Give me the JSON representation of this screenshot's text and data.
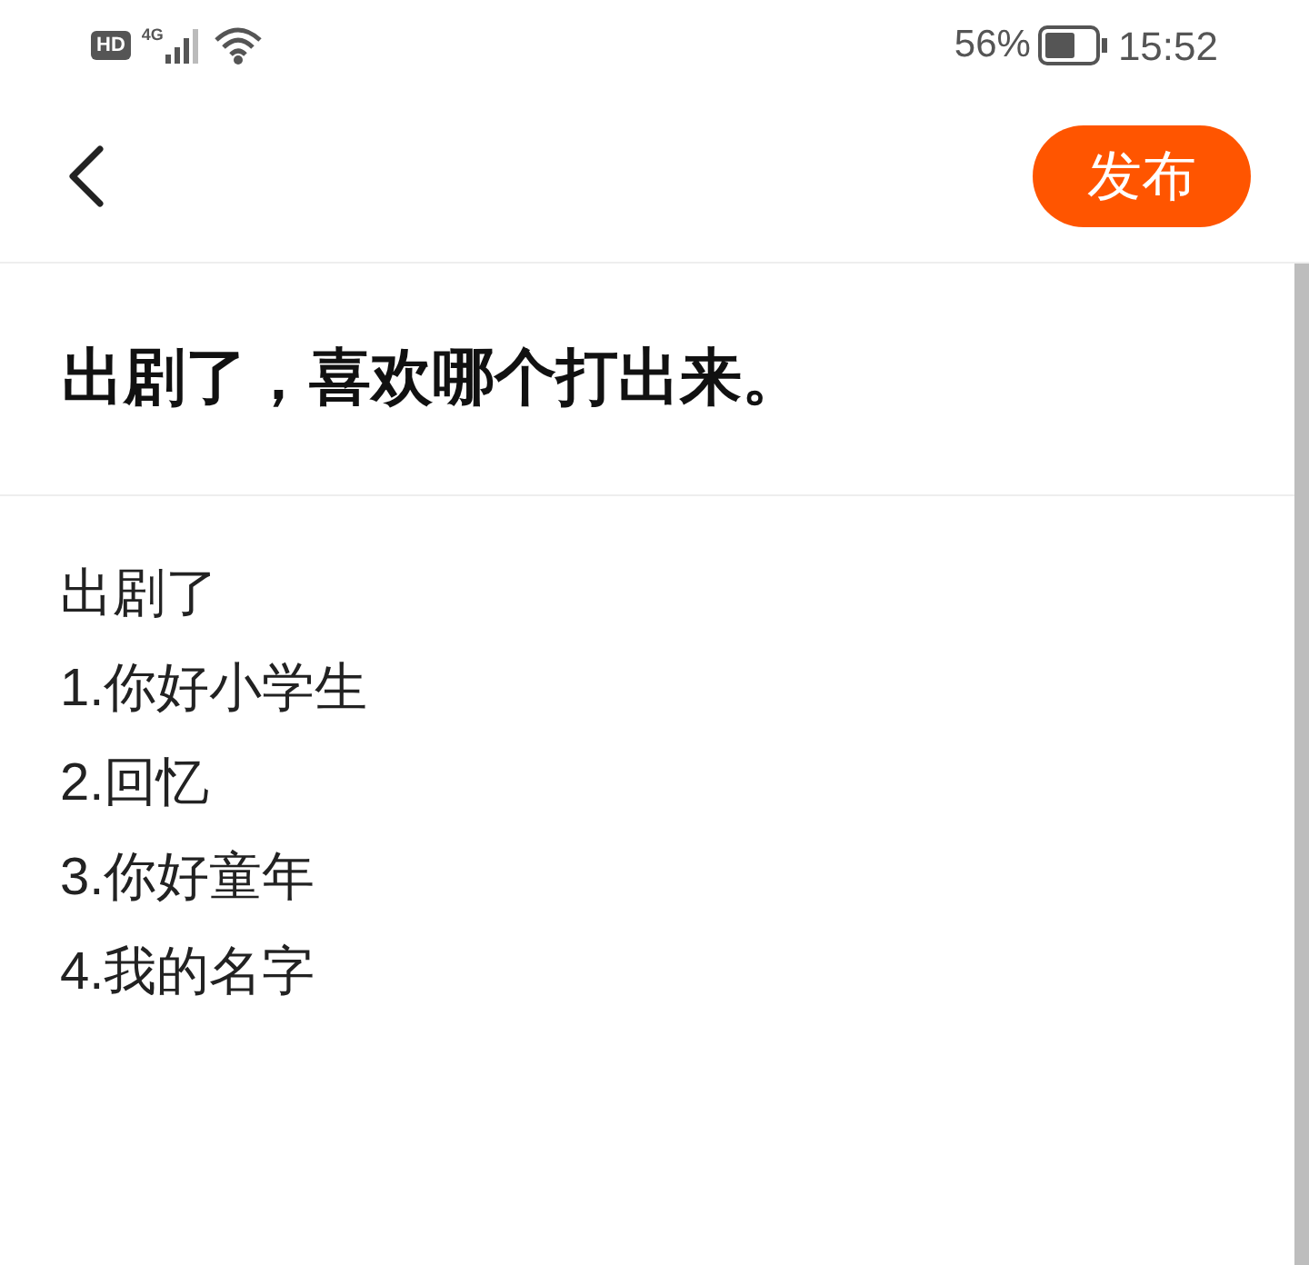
{
  "status_bar": {
    "hd": "HD",
    "network": "4G",
    "battery": "56%",
    "time": "15:52"
  },
  "header": {
    "publish_button": "发布"
  },
  "post": {
    "title": "出剧了，喜欢哪个打出来。",
    "body": [
      "出剧了",
      "1.你好小学生",
      "2.回忆",
      "3.你好童年",
      "4.我的名字"
    ]
  }
}
